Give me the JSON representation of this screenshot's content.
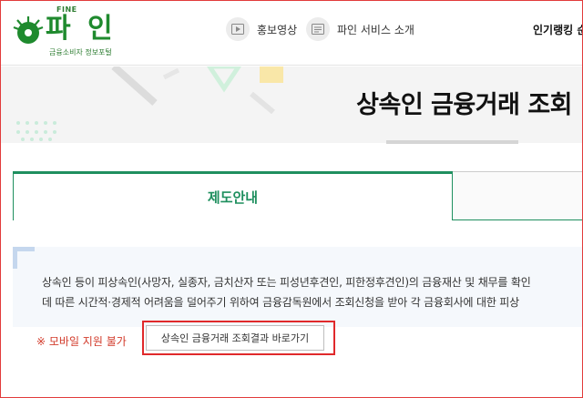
{
  "header": {
    "logo_top": "FINE",
    "logo_name": "파 인",
    "logo_sub": "금융소비자 정보포털",
    "nav": [
      {
        "label": "홍보영상",
        "icon": "play-icon"
      },
      {
        "label": "파인 서비스 소개",
        "icon": "document-icon"
      }
    ],
    "rank_label": "인기랭킹 순"
  },
  "banner": {
    "title": "상속인 금융거래 조회"
  },
  "tabs": {
    "active": "제도안내",
    "inactive": ""
  },
  "info": {
    "line1": "상속인 등이 피상속인(사망자, 실종자, 금치산자 또는 피성년후견인, 피한정후견인)의 금융재산 및 채무를 확인",
    "line2": "데 따른 시간적·경제적 어려움을 덜어주기 위하여 금융감독원에서 조회신청을 받아 각 금융회사에 대한 피상"
  },
  "bottom": {
    "mobile_note": "※ 모바일 지원 불가",
    "result_button": "상속인 금융거래 조회결과 바로가기"
  },
  "colors": {
    "brand_green": "#1f8a2e",
    "tab_green": "#1e8f5e",
    "warning_red": "#d23a2a",
    "highlight_red": "#e0292b"
  }
}
